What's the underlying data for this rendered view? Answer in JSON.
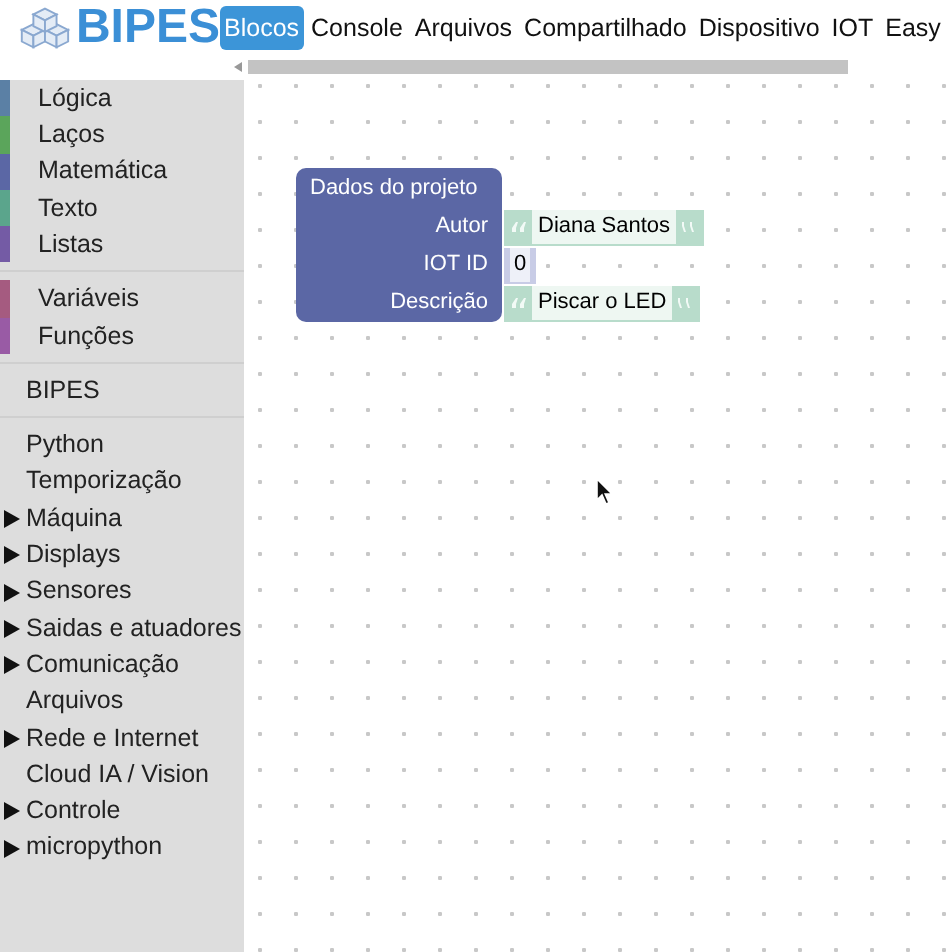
{
  "header": {
    "logo": "BIPES",
    "tabs": [
      {
        "label": "Blocos",
        "selected": true
      },
      {
        "label": "Console",
        "selected": false
      },
      {
        "label": "Arquivos",
        "selected": false
      },
      {
        "label": "Compartilhado",
        "selected": false
      },
      {
        "label": "Dispositivo",
        "selected": false
      },
      {
        "label": "IOT",
        "selected": false
      },
      {
        "label": "Easy",
        "selected": false
      }
    ]
  },
  "sidebar": {
    "groups": [
      [
        {
          "label": "Lógica",
          "color": "#5b80a5",
          "expandable": false
        },
        {
          "label": "Laços",
          "color": "#5ba55b",
          "expandable": false
        },
        {
          "label": "Matemática",
          "color": "#5b67a5",
          "expandable": false
        },
        {
          "label": "Texto",
          "color": "#5ba58c",
          "expandable": false
        },
        {
          "label": "Listas",
          "color": "#745ba5",
          "expandable": false
        }
      ],
      [
        {
          "label": "Variáveis",
          "color": "#a55b80",
          "expandable": false
        },
        {
          "label": "Funções",
          "color": "#995ba5",
          "expandable": false
        }
      ],
      [
        {
          "label": "BIPES",
          "expandable": false
        }
      ],
      [
        {
          "label": "Python",
          "expandable": false
        },
        {
          "label": "Temporização",
          "expandable": false
        },
        {
          "label": "Máquina",
          "expandable": true
        },
        {
          "label": "Displays",
          "expandable": true
        },
        {
          "label": "Sensores",
          "expandable": true
        },
        {
          "label": "Saidas e atuadores",
          "expandable": true
        },
        {
          "label": "Comunicação",
          "expandable": true
        },
        {
          "label": "Arquivos",
          "expandable": false
        },
        {
          "label": "Rede e Internet",
          "expandable": true
        },
        {
          "label": "Cloud IA / Vision",
          "expandable": false
        },
        {
          "label": "Controle",
          "expandable": true
        },
        {
          "label": "micropython",
          "expandable": true
        }
      ]
    ]
  },
  "block": {
    "title": "Dados do projeto",
    "fields": [
      {
        "label": "Autor",
        "kind": "text",
        "value": "Diana Santos"
      },
      {
        "label": "IOT ID",
        "kind": "number",
        "value": "0"
      },
      {
        "label": "Descrição",
        "kind": "text",
        "value": "Piscar o LED"
      }
    ]
  }
}
